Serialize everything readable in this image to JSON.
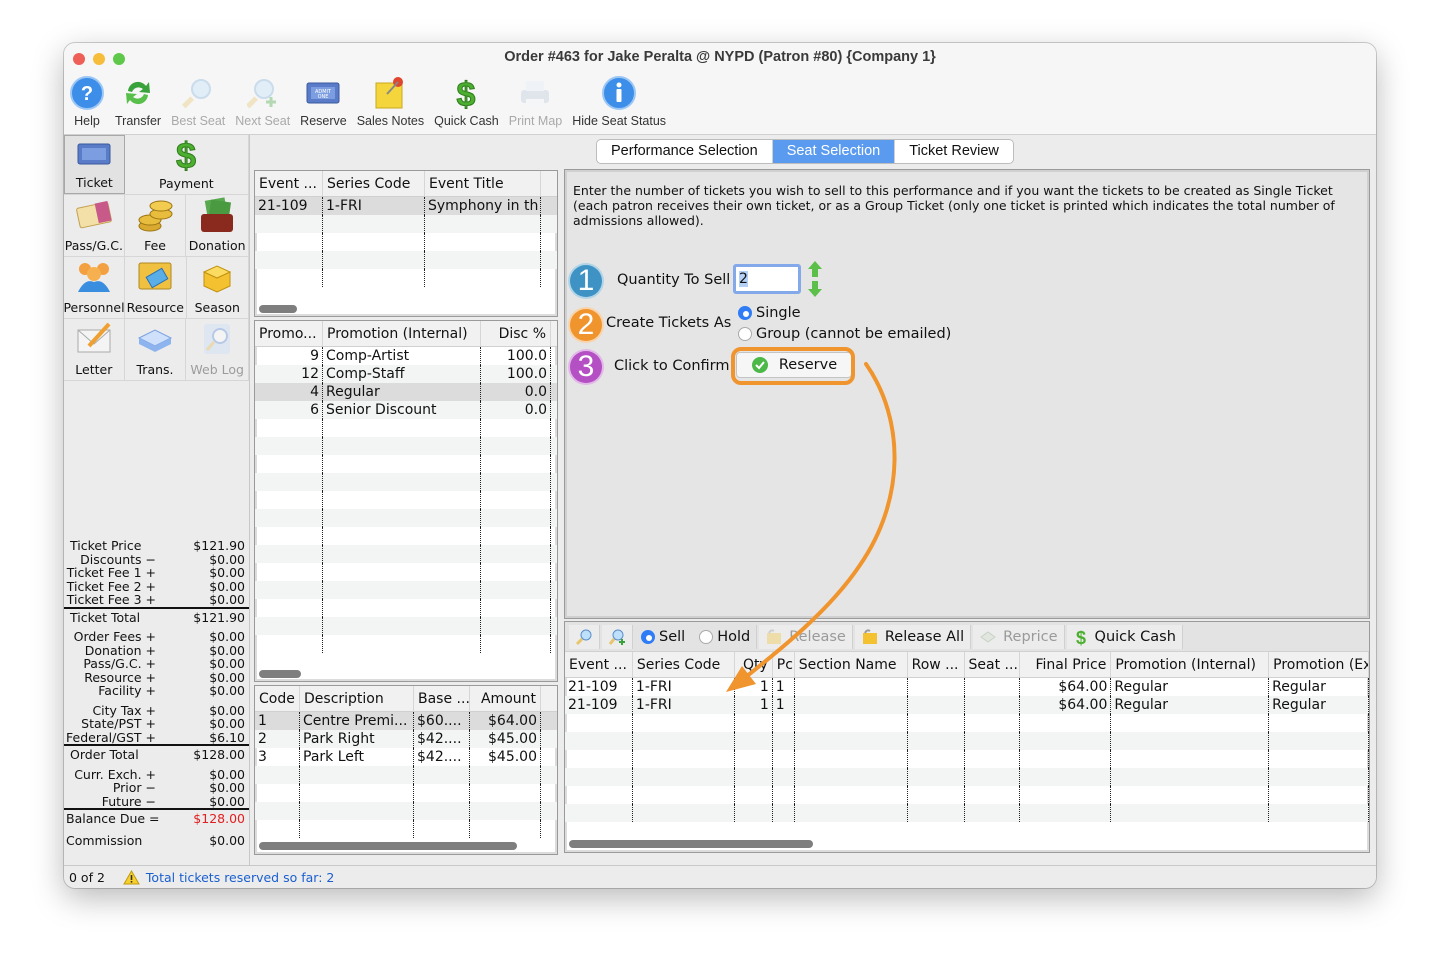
{
  "window": {
    "title": "Order #463 for Jake Peralta @ NYPD (Patron #80) {Company 1}"
  },
  "toolbar": [
    {
      "label": "Help",
      "icon": "help-icon",
      "enabled": true
    },
    {
      "label": "Transfer",
      "icon": "transfer-icon",
      "enabled": true
    },
    {
      "label": "Best Seat",
      "icon": "best-seat-icon",
      "enabled": false
    },
    {
      "label": "Next Seat",
      "icon": "next-seat-icon",
      "enabled": false
    },
    {
      "label": "Reserve",
      "icon": "ticket-icon",
      "enabled": true
    },
    {
      "label": "Sales Notes",
      "icon": "sales-notes-icon",
      "enabled": true
    },
    {
      "label": "Quick Cash",
      "icon": "dollar-icon",
      "enabled": true
    },
    {
      "label": "Print Map",
      "icon": "printer-icon",
      "enabled": false
    },
    {
      "label": "Hide Seat Status",
      "icon": "info-icon",
      "enabled": true
    }
  ],
  "palette": {
    "ticket": "Ticket",
    "payment": "Payment",
    "pass_gc": "Pass/G.C.",
    "fee": "Fee",
    "donation": "Donation",
    "personnel": "Personnel",
    "resource": "Resource",
    "season": "Season",
    "letter": "Letter",
    "trans": "Trans.",
    "web_log": "Web Log"
  },
  "totals": {
    "ticket_price": {
      "label": "Ticket Price",
      "value": "$121.90"
    },
    "discounts": {
      "label": "Discounts −",
      "value": "$0.00"
    },
    "ticket_fee_1": {
      "label": "Ticket Fee 1 +",
      "value": "$0.00"
    },
    "ticket_fee_2": {
      "label": "Ticket Fee 2 +",
      "value": "$0.00"
    },
    "ticket_fee_3": {
      "label": "Ticket Fee 3 +",
      "value": "$0.00"
    },
    "ticket_total": {
      "label": "Ticket Total",
      "value": "$121.90"
    },
    "order_fees": {
      "label": "Order Fees +",
      "value": "$0.00"
    },
    "donation": {
      "label": "Donation +",
      "value": "$0.00"
    },
    "pass_gc": {
      "label": "Pass/G.C. +",
      "value": "$0.00"
    },
    "resource": {
      "label": "Resource +",
      "value": "$0.00"
    },
    "facility": {
      "label": "Facility +",
      "value": "$0.00"
    },
    "city_tax": {
      "label": "City Tax +",
      "value": "$0.00"
    },
    "state_pst": {
      "label": "State/PST +",
      "value": "$0.00"
    },
    "federal_gst": {
      "label": "Federal/GST +",
      "value": "$6.10"
    },
    "order_total": {
      "label": "Order Total",
      "value": "$128.00"
    },
    "curr_exch": {
      "label": "Curr. Exch. +",
      "value": "$0.00"
    },
    "prior": {
      "label": "Prior −",
      "value": "$0.00"
    },
    "future": {
      "label": "Future −",
      "value": "$0.00"
    },
    "balance_due": {
      "label": "Balance Due =",
      "value": "$128.00",
      "color": "#e02020"
    },
    "commission": {
      "label": "Commission",
      "value": "$0.00"
    }
  },
  "events_table": {
    "headers": [
      "Event ...",
      "Series Code",
      "Event Title"
    ],
    "rows": [
      [
        "21-109",
        "1-FRI",
        "Symphony in th"
      ]
    ]
  },
  "promotions_table": {
    "headers": [
      "Promo...",
      "Promotion (Internal)",
      "Disc %"
    ],
    "rows": [
      [
        "9",
        "Comp-Artist",
        "100.0"
      ],
      [
        "12",
        "Comp-Staff",
        "100.0"
      ],
      [
        "4",
        "Regular",
        "0.0"
      ],
      [
        "6",
        "Senior Discount",
        "0.0"
      ]
    ],
    "selected_index": 2
  },
  "prices_table": {
    "headers": [
      "Code",
      "Description",
      "Base ...",
      "Amount"
    ],
    "rows": [
      [
        "1",
        "Centre Premi...",
        "$60....",
        "$64.00"
      ],
      [
        "2",
        "Park Right",
        "$42....",
        "$45.00"
      ],
      [
        "3",
        "Park Left",
        "$42....",
        "$45.00"
      ]
    ],
    "selected_index": 0
  },
  "tabs": [
    {
      "label": "Performance Selection",
      "active": false
    },
    {
      "label": "Seat Selection",
      "active": true
    },
    {
      "label": "Ticket Review",
      "active": false
    }
  ],
  "seat_selection": {
    "instructions": "Enter the number of tickets you wish to sell to this performance and if you want the tickets to be created as Single Ticket (each patron receives their own ticket, or as a Group Ticket (only one ticket is printed which indicates the total number of admissions allowed).",
    "step1": {
      "number": "1",
      "label": "Quantity To Sell",
      "value": "2",
      "color": "#3f93c4"
    },
    "step2": {
      "number": "2",
      "label": "Create Tickets As",
      "color": "#f0942e",
      "options": [
        {
          "label": "Single",
          "selected": true
        },
        {
          "label": "Group (cannot be emailed)",
          "selected": false
        }
      ]
    },
    "step3": {
      "number": "3",
      "label": "Click to Confirm",
      "color": "#b44fc4",
      "button": "Reserve"
    },
    "annotation_color": "#f0942e"
  },
  "cart": {
    "toolbar": {
      "sell": "Sell",
      "hold": "Hold",
      "mode": "Sell",
      "release": "Release",
      "release_all": "Release All",
      "reprice": "Reprice",
      "quick_cash": "Quick Cash"
    },
    "headers": [
      "Event ...",
      "Series Code",
      "Qty",
      "Pc",
      "Section Name",
      "Row ...",
      "Seat ...",
      "Final Price",
      "Promotion (Internal)",
      "Promotion (Ex"
    ],
    "rows": [
      [
        "21-109",
        "1-FRI",
        "1",
        "1",
        "",
        "",
        "",
        "$64.00",
        "Regular",
        "Regular"
      ],
      [
        "21-109",
        "1-FRI",
        "1",
        "1",
        "",
        "",
        "",
        "$64.00",
        "Regular",
        "Regular"
      ]
    ]
  },
  "status": {
    "count": "0 of 2",
    "message": "Total tickets reserved so far: 2"
  }
}
